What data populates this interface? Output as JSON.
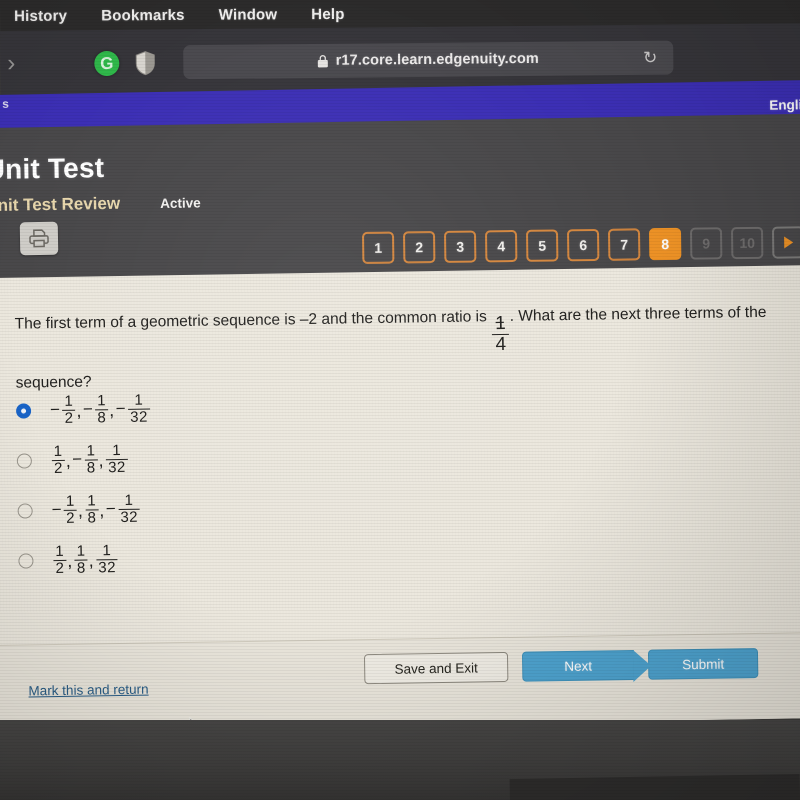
{
  "menubar": {
    "items": [
      {
        "label": "History"
      },
      {
        "label": "Bookmarks"
      },
      {
        "label": "Window"
      },
      {
        "label": "Help"
      }
    ]
  },
  "browser": {
    "back_forward_icon": "chevron-right-icon",
    "extensions": [
      {
        "name": "grammarly-extension-icon",
        "glyph": "G"
      },
      {
        "name": "shield-extension-icon",
        "glyph": "shield"
      }
    ],
    "address_bar": {
      "lock_icon": "lock-icon",
      "url": "r17.core.learn.edgenuity.com",
      "reload_icon": "reload-icon",
      "reload_glyph": "↻"
    }
  },
  "appbar": {
    "left_fragment": "s",
    "language": "Engli",
    "accent_color": "#3c2fb5"
  },
  "header": {
    "title": "Unit Test",
    "subtitle": "Unit Test Review",
    "status": "Active",
    "print_icon": "printer-icon"
  },
  "pager": {
    "buttons": [
      {
        "label": "1",
        "state": "available"
      },
      {
        "label": "2",
        "state": "available"
      },
      {
        "label": "3",
        "state": "available"
      },
      {
        "label": "4",
        "state": "available"
      },
      {
        "label": "5",
        "state": "available"
      },
      {
        "label": "6",
        "state": "available"
      },
      {
        "label": "7",
        "state": "available"
      },
      {
        "label": "8",
        "state": "active"
      },
      {
        "label": "9",
        "state": "disabled"
      },
      {
        "label": "10",
        "state": "disabled"
      }
    ],
    "next_arrow_icon": "play-arrow-icon",
    "active_color": "#ef9326",
    "outline_color": "#d4873f"
  },
  "question": {
    "text_part_1": "The first term of a geometric sequence is –2 and the common ratio is ",
    "ratio": {
      "sign": "−",
      "numerator": "1",
      "denominator": "4"
    },
    "text_part_2": ". What are the next three terms of the sequence?"
  },
  "options": [
    {
      "id": "option-a",
      "selected": true,
      "terms": [
        {
          "sign": "−",
          "numerator": "1",
          "denominator": "2"
        },
        {
          "sign": "−",
          "numerator": "1",
          "denominator": "8"
        },
        {
          "sign": "−",
          "numerator": "1",
          "denominator": "32"
        }
      ]
    },
    {
      "id": "option-b",
      "selected": false,
      "terms": [
        {
          "sign": "",
          "numerator": "1",
          "denominator": "2"
        },
        {
          "sign": "−",
          "numerator": "1",
          "denominator": "8"
        },
        {
          "sign": "",
          "numerator": "1",
          "denominator": "32"
        }
      ]
    },
    {
      "id": "option-c",
      "selected": false,
      "terms": [
        {
          "sign": "−",
          "numerator": "1",
          "denominator": "2"
        },
        {
          "sign": "",
          "numerator": "1",
          "denominator": "8"
        },
        {
          "sign": "−",
          "numerator": "1",
          "denominator": "32"
        }
      ]
    },
    {
      "id": "option-d",
      "selected": false,
      "terms": [
        {
          "sign": "",
          "numerator": "1",
          "denominator": "2"
        },
        {
          "sign": "",
          "numerator": "1",
          "denominator": "8"
        },
        {
          "sign": "",
          "numerator": "1",
          "denominator": "32"
        }
      ]
    }
  ],
  "footer": {
    "mark_link": "Mark this and return",
    "save_label": "Save and Exit",
    "next_label": "Next",
    "submit_label": "Submit",
    "button_color": "#4ea3cf"
  },
  "cursor": {
    "icon": "mouse-pointer-icon"
  }
}
